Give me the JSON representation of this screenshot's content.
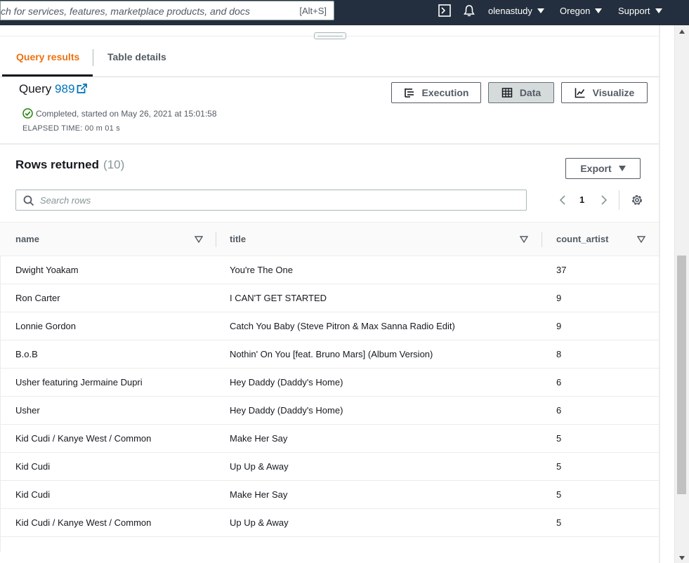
{
  "topnav": {
    "search_placeholder": "ch for services, features, marketplace products, and docs",
    "search_shortcut": "[Alt+S]",
    "cloudshell_icon": "terminal-icon",
    "bell_icon": "bell-icon",
    "account": "olenastudy",
    "region": "Oregon",
    "support": "Support"
  },
  "tabs": {
    "query_results": "Query results",
    "table_details": "Table details"
  },
  "query": {
    "label": "Query",
    "id": "989",
    "status": "Completed, started on May 26, 2021 at 15:01:58",
    "elapsed": "ELAPSED TIME: 00 m 01 s"
  },
  "toolbar": {
    "execution": "Execution",
    "data": "Data",
    "visualize": "Visualize"
  },
  "results": {
    "title": "Rows returned",
    "count": "(10)",
    "export": "Export",
    "search_placeholder": "Search rows",
    "page": "1"
  },
  "table": {
    "columns": [
      "name",
      "title",
      "count_artist"
    ],
    "rows": [
      [
        "Dwight Yoakam",
        "You're The One",
        "37"
      ],
      [
        "Ron Carter",
        "I CAN'T GET STARTED",
        "9"
      ],
      [
        "Lonnie Gordon",
        "Catch You Baby (Steve Pitron & Max Sanna Radio Edit)",
        "9"
      ],
      [
        "B.o.B",
        "Nothin' On You [feat. Bruno Mars] (Album Version)",
        "8"
      ],
      [
        "Usher featuring Jermaine Dupri",
        "Hey Daddy (Daddy's Home)",
        "6"
      ],
      [
        "Usher",
        "Hey Daddy (Daddy's Home)",
        "6"
      ],
      [
        "Kid Cudi / Kanye West / Common",
        "Make Her Say",
        "5"
      ],
      [
        "Kid Cudi",
        "Up Up & Away",
        "5"
      ],
      [
        "Kid Cudi",
        "Make Her Say",
        "5"
      ],
      [
        "Kid Cudi / Kanye West / Common",
        "Up Up & Away",
        "5"
      ]
    ]
  },
  "colors": {
    "nav_bg": "#232f3e",
    "active_tab": "#ec7211",
    "link": "#0073bb",
    "success": "#1d8102"
  }
}
